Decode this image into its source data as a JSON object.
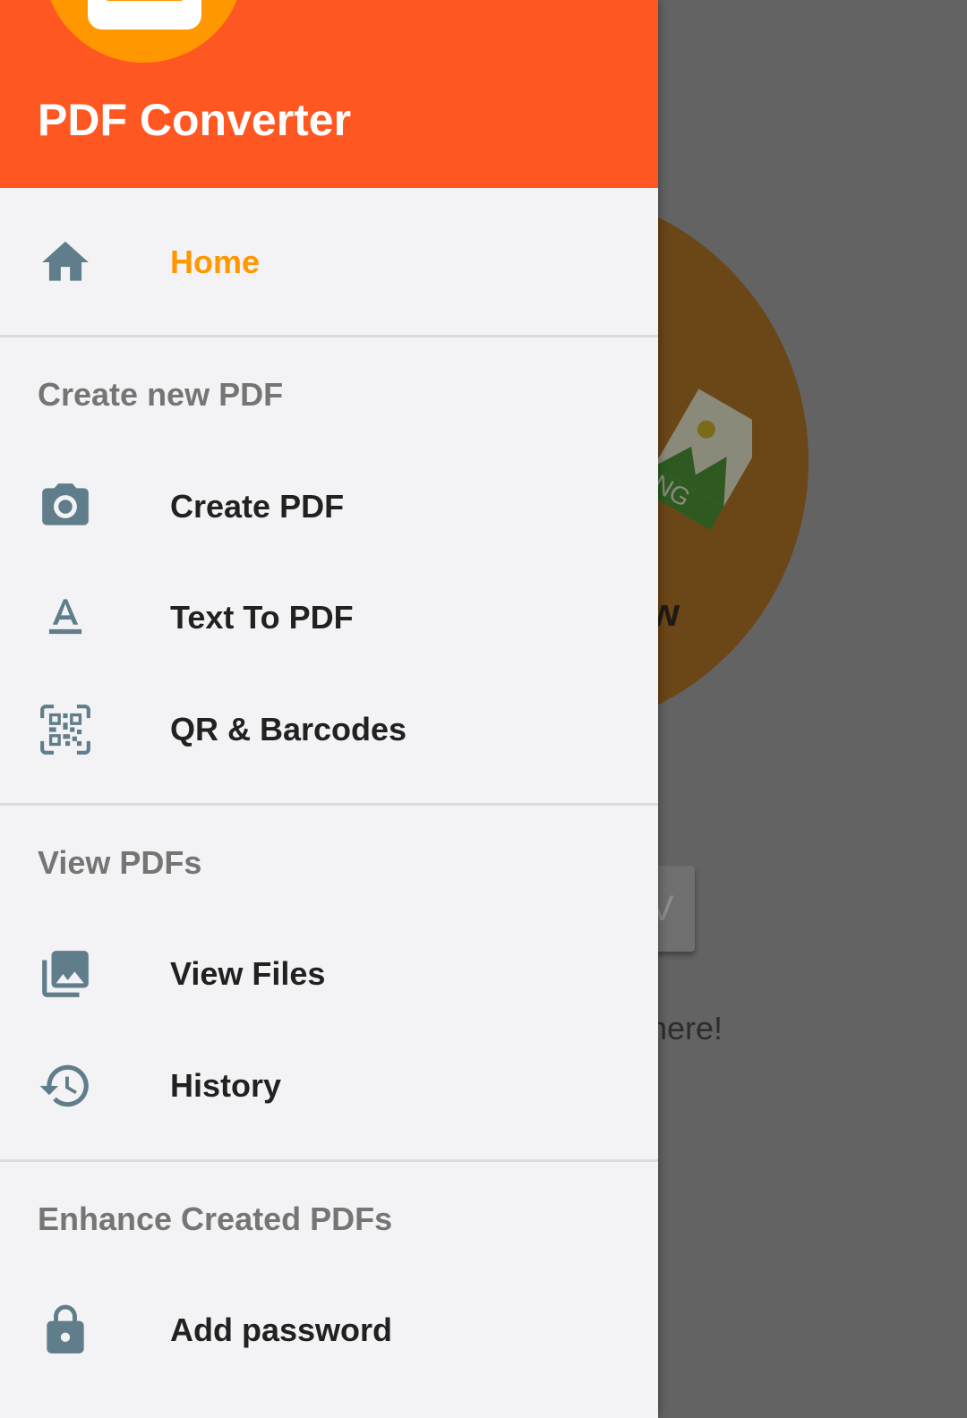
{
  "drawer": {
    "title": "PDF Converter",
    "home": {
      "label": "Home",
      "icon": "home-icon",
      "active": true
    },
    "sections": [
      {
        "title": "Create new PDF",
        "items": [
          {
            "label": "Create PDF",
            "icon": "camera-icon"
          },
          {
            "label": "Text To PDF",
            "icon": "text-format-icon"
          },
          {
            "label": "QR & Barcodes",
            "icon": "qr-code-scan-icon"
          }
        ]
      },
      {
        "title": "View PDFs",
        "items": [
          {
            "label": "View Files",
            "icon": "photo-library-icon"
          },
          {
            "label": "History",
            "icon": "history-icon"
          }
        ]
      },
      {
        "title": "Enhance Created PDFs",
        "items": [
          {
            "label": "Add password",
            "icon": "lock-icon"
          }
        ]
      }
    ]
  },
  "background": {
    "heading_fragment": "w",
    "button_fragment": "V",
    "hint_fragment": "here!",
    "image_badge_fragment": "NG"
  },
  "colors": {
    "header": "#ff5722",
    "logo": "#ff9800",
    "active_text": "#ff9800",
    "icon": "#607d8b",
    "drawer_bg": "#f3f3f5",
    "scrim_bg": "#636363"
  }
}
